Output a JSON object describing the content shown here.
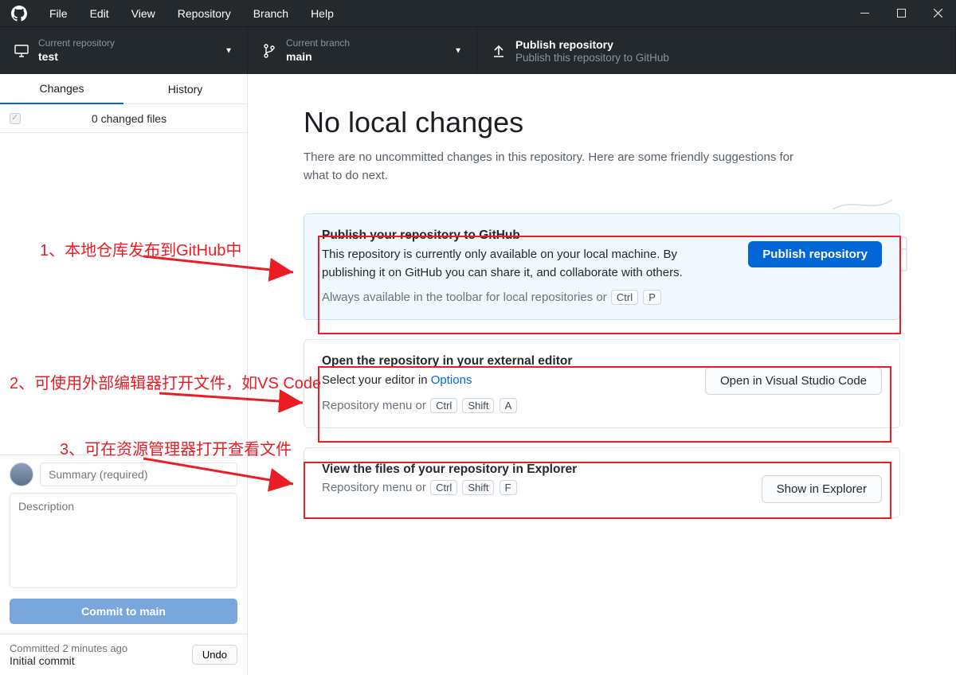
{
  "menu": {
    "file": "File",
    "edit": "Edit",
    "view": "View",
    "repository": "Repository",
    "branch": "Branch",
    "help": "Help"
  },
  "toolbar": {
    "repo_label": "Current repository",
    "repo_value": "test",
    "branch_label": "Current branch",
    "branch_value": "main",
    "publish_title": "Publish repository",
    "publish_sub": "Publish this repository to GitHub"
  },
  "sidebar": {
    "tab_changes": "Changes",
    "tab_history": "History",
    "files_header": "0 changed files",
    "summary_placeholder": "Summary (required)",
    "description_placeholder": "Description",
    "commit_prefix": "Commit to ",
    "commit_branch": "main",
    "last_commit_time": "Committed 2 minutes ago",
    "last_commit_msg": "Initial commit",
    "undo": "Undo"
  },
  "content": {
    "heading": "No local changes",
    "subtitle": "There are no uncommitted changes in this repository. Here are some friendly suggestions for what to do next.",
    "card1": {
      "title": "Publish your repository to GitHub",
      "desc": "This repository is currently only available on your local machine. By publishing it on GitHub you can share it, and collaborate with others.",
      "tip_prefix": "Always available in the toolbar for local repositories or",
      "key1": "Ctrl",
      "key2": "P",
      "button": "Publish repository"
    },
    "card2": {
      "title": "Open the repository in your external editor",
      "desc_prefix": "Select your editor in ",
      "desc_link": "Options",
      "tip_prefix": "Repository menu or",
      "key1": "Ctrl",
      "key2": "Shift",
      "key3": "A",
      "button": "Open in Visual Studio Code"
    },
    "card3": {
      "title": "View the files of your repository in Explorer",
      "tip_prefix": "Repository menu or",
      "key1": "Ctrl",
      "key2": "Shift",
      "key3": "F",
      "button": "Show in Explorer"
    }
  },
  "annotations": {
    "a1": "1、本地仓库发布到GitHub中",
    "a2": "2、可使用外部编辑器打开文件，如VS Code",
    "a3": "3、可在资源管理器打开查看文件"
  }
}
